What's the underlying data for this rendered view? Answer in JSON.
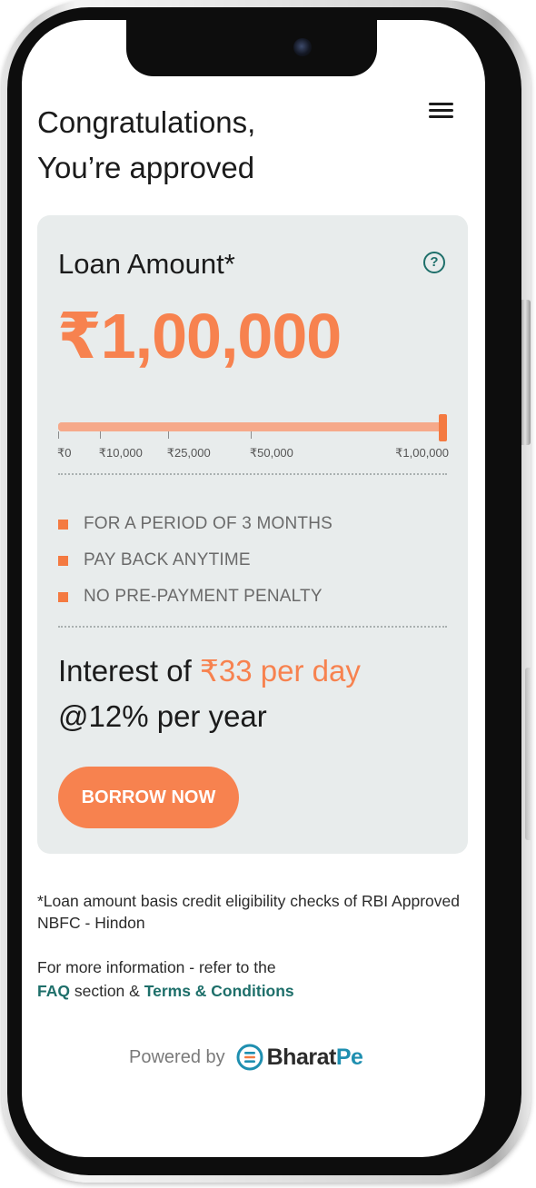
{
  "header": {
    "title_line1": "Congratulations,",
    "title_line2": "You’re approved",
    "menu_icon": "hamburger-menu-icon"
  },
  "loan_card": {
    "title": "Loan Amount*",
    "help_icon": "question-circle-icon",
    "help_glyph": "?",
    "amount": "₹1,00,000",
    "slider": {
      "min": 0,
      "max": 100000,
      "value": 100000,
      "ticks": [
        {
          "value": 0,
          "label": "₹0"
        },
        {
          "value": 10000,
          "label": "₹10,000"
        },
        {
          "value": 25000,
          "label": "₹25,000"
        },
        {
          "value": 50000,
          "label": "₹50,000"
        },
        {
          "value": 100000,
          "label": "₹1,00,000"
        }
      ]
    },
    "features": [
      "FOR A PERIOD OF 3 MONTHS",
      "PAY BACK ANYTIME",
      "NO PRE-PAYMENT PENALTY"
    ],
    "interest_prefix": "Interest of ",
    "interest_highlight": "₹33 per day",
    "interest_line2": "@12% per year",
    "cta": "BORROW NOW"
  },
  "footer": {
    "disclaimer": "*Loan amount basis credit eligibility checks of RBI Approved NBFC - Hindon",
    "more_info_prefix": "For more information - refer to the",
    "faq_link": "FAQ",
    "section_and": " section & ",
    "terms_link": "Terms & Conditions",
    "powered_by": "Powered by",
    "brand_main": "Bharat",
    "brand_suffix": "Pe",
    "brand_icon": "bharatpe-logo-icon"
  },
  "colors": {
    "accent": "#f7824f",
    "slider_track": "#f6a98a",
    "card_bg": "#e8ecec",
    "link": "#1e6f6a",
    "brand_blue": "#1f8fb0"
  }
}
